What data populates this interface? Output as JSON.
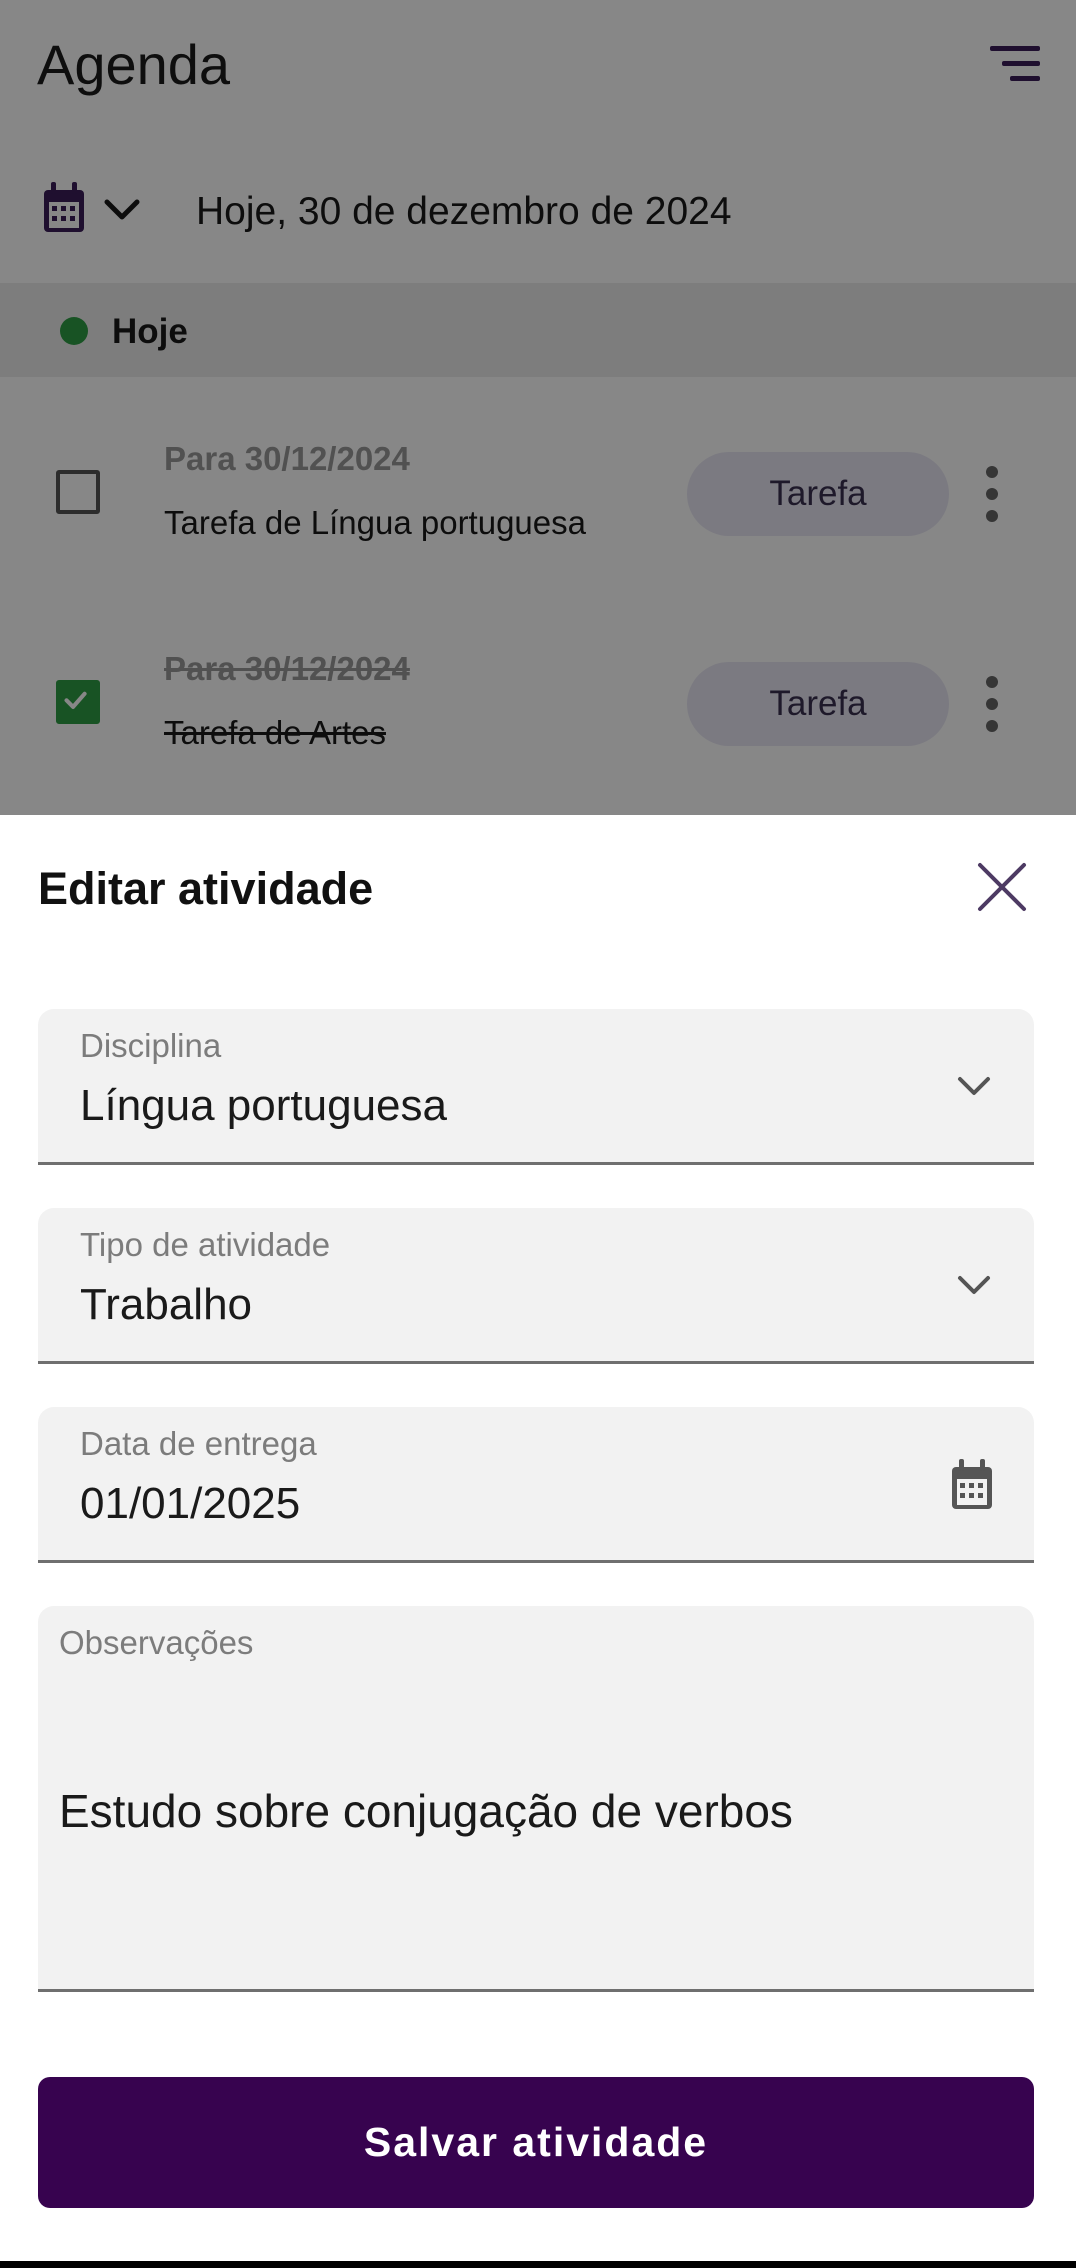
{
  "app": {
    "title": "Agenda",
    "date_label": "Hoje, 30 de dezembro de 2024",
    "today_section": "Hoje"
  },
  "tasks": [
    {
      "due": "Para 30/12/2024",
      "name": "Tarefa de Língua portuguesa",
      "tag": "Tarefa",
      "done": false
    },
    {
      "due": "Para 30/12/2024",
      "name": "Tarefa de Artes",
      "tag": "Tarefa",
      "done": true
    }
  ],
  "sheet": {
    "title": "Editar atividade",
    "fields": {
      "discipline": {
        "label": "Disciplina",
        "value": "Língua portuguesa"
      },
      "activity_type": {
        "label": "Tipo de atividade",
        "value": "Trabalho"
      },
      "due_date": {
        "label": "Data de entrega",
        "value": "01/01/2025"
      },
      "notes": {
        "label": "Observações",
        "value": "Estudo sobre conjugação de verbos"
      }
    },
    "save_label": "Salvar atividade"
  },
  "colors": {
    "primary": "#37034f",
    "accent": "#3b1e5a",
    "success": "#2e9e45",
    "chip_bg": "#e8e7f4"
  },
  "icons": [
    "menu-icon",
    "calendar-icon",
    "chevron-down-icon",
    "checkbox-icon",
    "more-vertical-icon",
    "close-icon"
  ]
}
